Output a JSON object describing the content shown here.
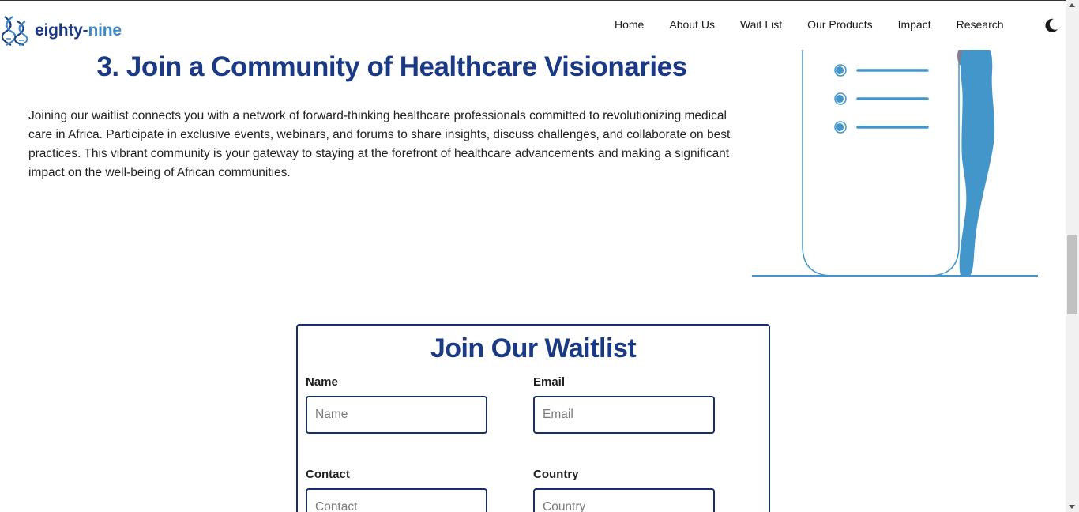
{
  "brand": {
    "name_part1": "eighty-",
    "name_part2": "nine",
    "primary_color": "#1b3a86",
    "accent_color": "#3e88c8",
    "logo_icon": "dna-helix-icon"
  },
  "nav": {
    "items": [
      {
        "label": "Home"
      },
      {
        "label": "About Us"
      },
      {
        "label": "Wait List"
      },
      {
        "label": "Our Products"
      },
      {
        "label": "Impact"
      },
      {
        "label": "Research"
      }
    ],
    "theme_toggle_icon": "moon-icon"
  },
  "section": {
    "title": "3. Join a Community of Healthcare Visionaries",
    "body": "Joining our waitlist connects you with a network of forward-thinking healthcare professionals committed to revolutionizing medical care in Africa. Participate in exclusive events, webinars, and forums to share insights, discuss challenges, and collaborate on best practices. This vibrant community is your gateway to staying at the forefront of healthcare advancements and making a significant impact on the well-being of African communities."
  },
  "illustration": {
    "icon": "phone-checklist-person-illustration",
    "color": "#4396c9"
  },
  "waitlist": {
    "title": "Join Our Waitlist",
    "fields": {
      "name": {
        "label": "Name",
        "placeholder": "Name",
        "value": ""
      },
      "email": {
        "label": "Email",
        "placeholder": "Email",
        "value": ""
      },
      "contact": {
        "label": "Contact",
        "placeholder": "Contact",
        "value": ""
      },
      "country": {
        "label": "Country",
        "placeholder": "Country",
        "value": ""
      }
    }
  }
}
